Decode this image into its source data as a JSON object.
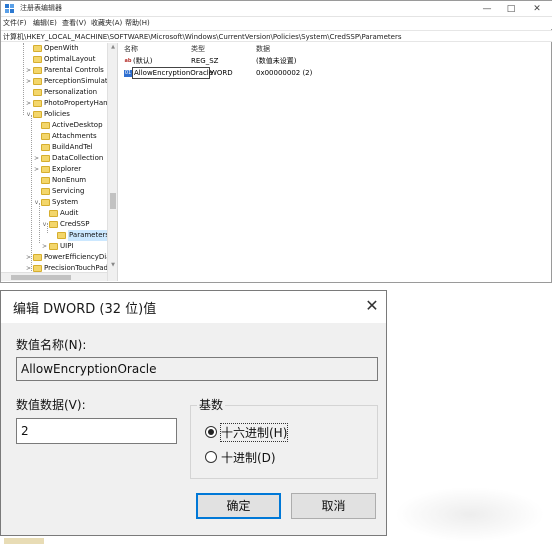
{
  "regedit": {
    "title": "注册表编辑器",
    "controls": {
      "minimize": "—",
      "maximize": "□",
      "close": "✕"
    },
    "menu": [
      "文件(F)",
      "编辑(E)",
      "查看(V)",
      "收藏夹(A)",
      "帮助(H)"
    ],
    "address": "计算机\\HKEY_LOCAL_MACHINE\\SOFTWARE\\Microsoft\\Windows\\CurrentVersion\\Policies\\System\\CredSSP\\Parameters",
    "tree": [
      {
        "label": "OpenWith",
        "expander": ""
      },
      {
        "label": "OptimalLayout",
        "expander": ""
      },
      {
        "label": "Parental Controls",
        "expander": ">"
      },
      {
        "label": "PerceptionSimulatio",
        "expander": ">"
      },
      {
        "label": "Personalization",
        "expander": ""
      },
      {
        "label": "PhotoPropertyHandl",
        "expander": ">"
      },
      {
        "label": "Policies",
        "expander": "v"
      },
      {
        "label": "ActiveDesktop",
        "expander": ""
      },
      {
        "label": "Attachments",
        "expander": ""
      },
      {
        "label": "BuildAndTel",
        "expander": ""
      },
      {
        "label": "DataCollection",
        "expander": ">"
      },
      {
        "label": "Explorer",
        "expander": ">"
      },
      {
        "label": "NonEnum",
        "expander": ""
      },
      {
        "label": "Servicing",
        "expander": ""
      },
      {
        "label": "System",
        "expander": "v"
      },
      {
        "label": "Audit",
        "expander": ""
      },
      {
        "label": "CredSSP",
        "expander": "v"
      },
      {
        "label": "Parameters",
        "expander": ""
      },
      {
        "label": "UIPI",
        "expander": ">"
      },
      {
        "label": "PowerEfficiencyDiagr",
        "expander": ">"
      },
      {
        "label": "PrecisionTouchPad",
        "expander": ">"
      }
    ],
    "columns": {
      "name": "名称",
      "type": "类型",
      "data": "数据"
    },
    "rows": [
      {
        "icon": "ab",
        "name": "(默认)",
        "type": "REG_SZ",
        "data": "(数值未设置)"
      },
      {
        "icon": "01",
        "name": "AllowEncryptionOracle",
        "type": "REG_DWORD",
        "type_visible": "WORD",
        "data": "0x00000002 (2)"
      }
    ]
  },
  "dialog": {
    "title": "编辑 DWORD (32 位)值",
    "close": "✕",
    "name_label": "数值名称(N):",
    "name_value": "AllowEncryptionOracle",
    "value_label": "数值数据(V):",
    "value_data": "2",
    "base_label": "基数",
    "hex_label": "十六进制(H)",
    "dec_label": "十进制(D)",
    "selected_base": "hex",
    "ok_label": "确定",
    "cancel_label": "取消"
  }
}
